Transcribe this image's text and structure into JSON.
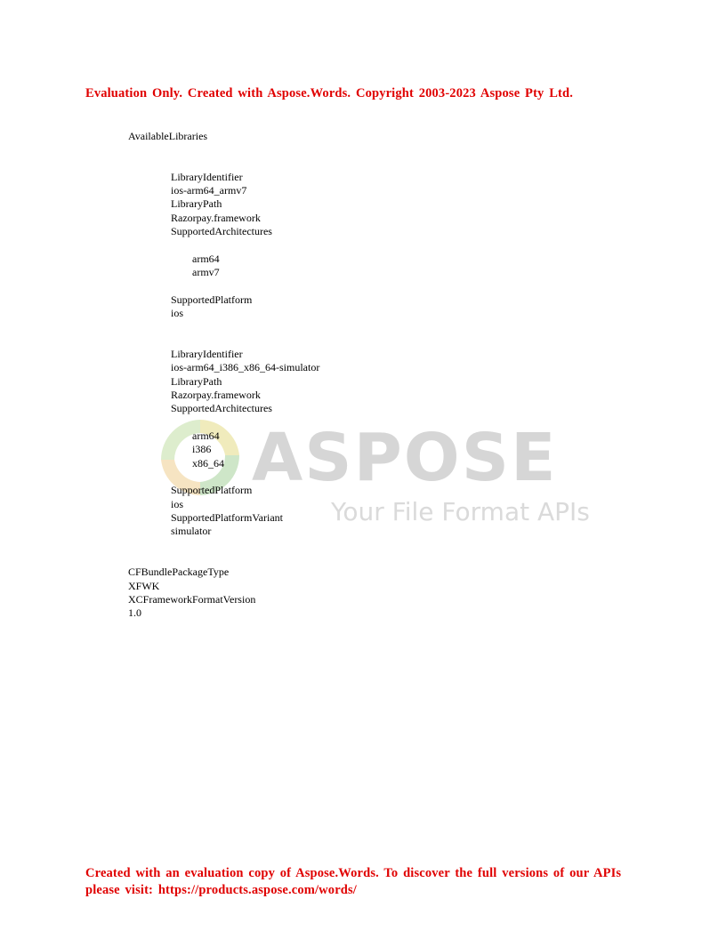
{
  "evaluation_banner": {
    "header": "Evaluation Only. Created with Aspose.Words. Copyright 2003-2023 Aspose Pty Ltd.",
    "footer_line1": "Created with an evaluation copy of Aspose.Words. To discover the full versions of our APIs",
    "footer_line2": "please visit: https://products.aspose.com/words/"
  },
  "watermark": {
    "brand": "ASPOSE",
    "tagline": "Your File Format APIs"
  },
  "document": {
    "root_key": "AvailableLibraries",
    "libraries": [
      {
        "identifier_key": "LibraryIdentifier",
        "identifier_value": "ios-arm64_armv7",
        "path_key": "LibraryPath",
        "path_value": "Razorpay.framework",
        "archs_key": "SupportedArchitectures",
        "archs": [
          "arm64",
          "armv7"
        ],
        "platform_key": "SupportedPlatform",
        "platform_value": "ios"
      },
      {
        "identifier_key": "LibraryIdentifier",
        "identifier_value": "ios-arm64_i386_x86_64-simulator",
        "path_key": "LibraryPath",
        "path_value": "Razorpay.framework",
        "archs_key": "SupportedArchitectures",
        "archs": [
          "arm64",
          "i386",
          "x86_64"
        ],
        "platform_key": "SupportedPlatform",
        "platform_value": "ios",
        "variant_key": "SupportedPlatformVariant",
        "variant_value": "simulator"
      }
    ],
    "package_type_key": "CFBundlePackageType",
    "package_type_value": "XFWK",
    "format_version_key": "XCFrameworkFormatVersion",
    "format_version_value": "1.0"
  },
  "colors": {
    "banner_red": "#e00000",
    "watermark_gray": "#cfcfcf"
  }
}
